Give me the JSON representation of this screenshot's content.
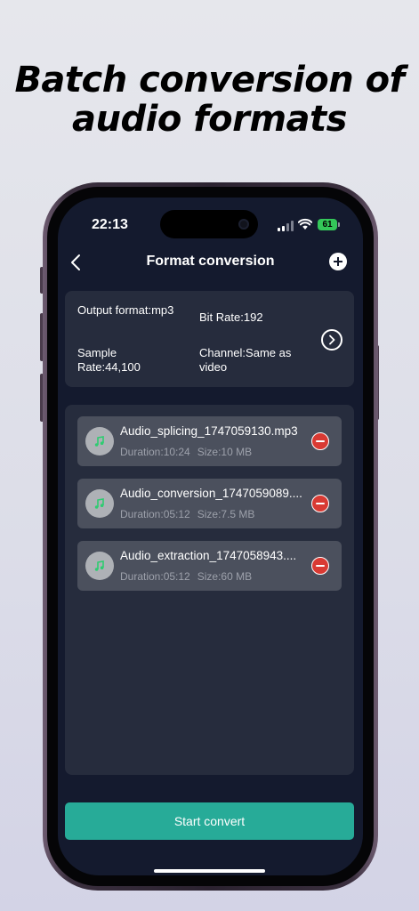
{
  "promo": {
    "title_line1": "Batch conversion of",
    "title_line2": "audio formats"
  },
  "status_bar": {
    "time": "22:13",
    "battery": "61"
  },
  "nav": {
    "title": "Format conversion",
    "back_icon": "chevron-left-icon",
    "add_icon": "plus-circle-icon"
  },
  "settings": {
    "output_format": "Output format:mp3",
    "bit_rate": "Bit Rate:192",
    "sample_rate": "Sample Rate:44,100",
    "channel": "Channel:Same as video",
    "arrow_icon": "chevron-right-circle-icon"
  },
  "files": [
    {
      "name": "Audio_splicing_1747059130.mp3",
      "duration": "Duration:10:24",
      "size": "Size:10 MB"
    },
    {
      "name": "Audio_conversion_1747059089....",
      "duration": "Duration:05:12",
      "size": "Size:7.5 MB"
    },
    {
      "name": "Audio_extraction_1747058943....",
      "duration": "Duration:05:12",
      "size": "Size:60 MB"
    }
  ],
  "actions": {
    "start_convert": "Start convert"
  },
  "colors": {
    "accent": "#27ab98",
    "screen_bg": "#141a2e",
    "card_bg": "#262c3d",
    "item_bg": "#4b505d",
    "remove": "#d93a33",
    "music_note": "#2ecc71"
  }
}
